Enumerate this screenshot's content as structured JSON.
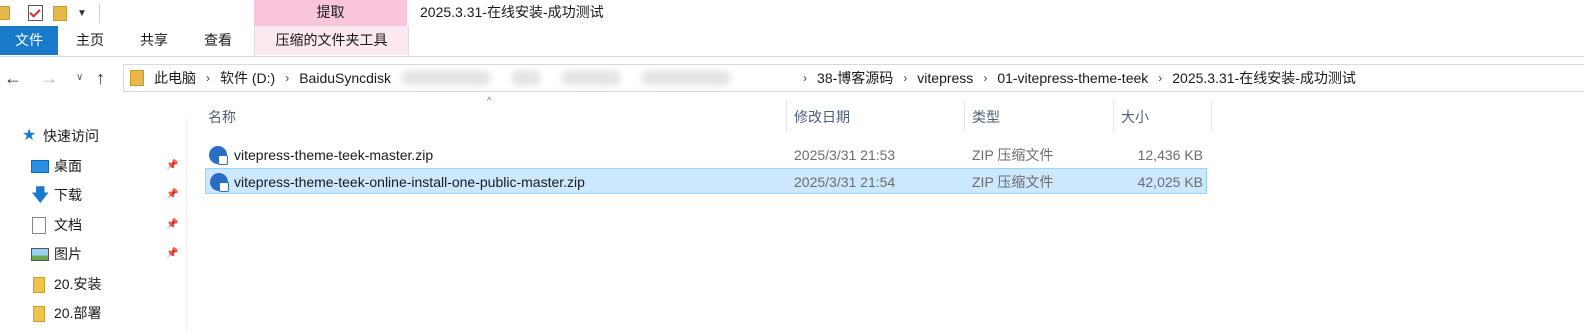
{
  "window": {
    "title": "2025.3.31-在线安装-成功测试",
    "context_tab_group": "提取"
  },
  "ribbon": {
    "tabs": [
      {
        "label": "文件",
        "active": true
      },
      {
        "label": "主页"
      },
      {
        "label": "共享"
      },
      {
        "label": "查看"
      },
      {
        "label": "压缩的文件夹工具"
      }
    ]
  },
  "nav": {
    "back_icon": "←",
    "forward_icon": "→",
    "recent_icon": "∨",
    "up_icon": "↑"
  },
  "address": {
    "crumbs": [
      "此电脑",
      "软件 (D:)",
      "BaiduSyncdisk",
      "38-博客源码",
      "vitepress",
      "01-vitepress-theme-teek",
      "2025.3.31-在线安装-成功测试"
    ],
    "separator": "›"
  },
  "columns": {
    "name": "名称",
    "date": "修改日期",
    "type": "类型",
    "size": "大小",
    "sort_indicator": "^"
  },
  "sidebar": {
    "quick_access": "快速访问",
    "items": [
      {
        "label": "桌面",
        "icon": "desktop-icon",
        "pinned": true
      },
      {
        "label": "下载",
        "icon": "download-icon",
        "pinned": true
      },
      {
        "label": "文档",
        "icon": "document-icon",
        "pinned": true
      },
      {
        "label": "图片",
        "icon": "pictures-icon",
        "pinned": true
      },
      {
        "label": "20.安装",
        "icon": "folder-icon"
      },
      {
        "label": "20.部署",
        "icon": "folder-icon"
      }
    ],
    "pin_glyph": "📌"
  },
  "files": [
    {
      "name": "vitepress-theme-teek-master.zip",
      "date": "2025/3/31 21:53",
      "type": "ZIP 压缩文件",
      "size": "12,436 KB",
      "selected": false
    },
    {
      "name": "vitepress-theme-teek-online-install-one-public-master.zip",
      "date": "2025/3/31 21:54",
      "type": "ZIP 压缩文件",
      "size": "42,025 KB",
      "selected": true
    }
  ],
  "colors": {
    "file_tab_bg": "#1979ca",
    "context_tab_bg": "#f8c5dd",
    "selection_bg": "#cce8ff",
    "selection_border": "#99d1ff"
  }
}
